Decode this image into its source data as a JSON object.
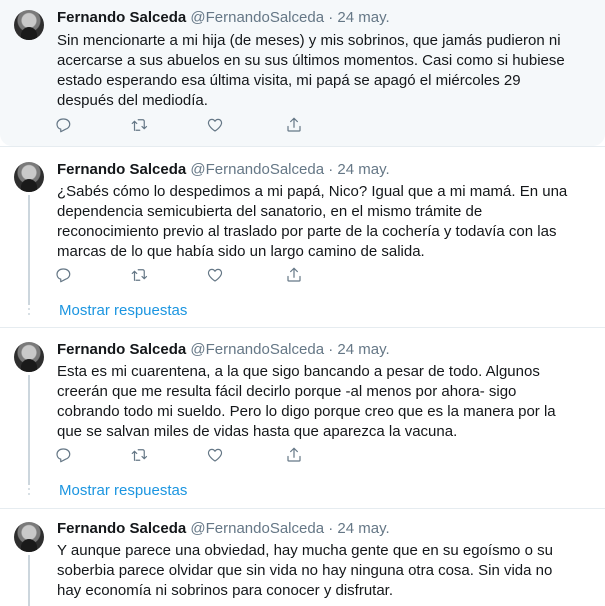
{
  "tweets": [
    {
      "name": "Fernando Salceda",
      "handle": "@FernandoSalceda",
      "dot": "·",
      "date": "24 may.",
      "lines": [
        "Sin mencionarte a mi hija (de meses) y mis sobrinos, que jamás pudieron ni",
        "acercarse a sus abuelos en su sus últimos momentos. Casi como si hubiese",
        "estado esperando esa última visita, mi papá se apagó el miércoles 29",
        "después del mediodía."
      ]
    },
    {
      "name": "Fernando Salceda",
      "handle": "@FernandoSalceda",
      "dot": "·",
      "date": "24 may.",
      "lines": [
        "¿Sabés cómo lo despedimos a mi papá, Nico? Igual que a mi mamá. En una",
        "dependencia semicubierta del sanatorio, en el mismo trámite de",
        "reconocimiento previo al traslado por parte de la cochería y todavía con las",
        "marcas de lo que había sido un largo camino de salida."
      ],
      "show_replies": "Mostrar respuestas"
    },
    {
      "name": "Fernando Salceda",
      "handle": "@FernandoSalceda",
      "dot": "·",
      "date": "24 may.",
      "lines": [
        "Esta es mi cuarentena, a la que sigo bancando a pesar de todo. Algunos",
        "creerán que me resulta fácil decirlo porque -al menos por ahora- sigo",
        "cobrando todo mi sueldo. Pero lo digo porque creo que es la manera por la",
        "que se salvan miles de vidas hasta que aparezca la vacuna."
      ],
      "show_replies": "Mostrar respuestas"
    },
    {
      "name": "Fernando Salceda",
      "handle": "@FernandoSalceda",
      "dot": "·",
      "date": "24 may.",
      "lines": [
        "Y aunque parece una obviedad, hay mucha gente que en su egoísmo o su",
        "soberbia parece olvidar que sin vida no hay ninguna otra cosa. Sin vida no",
        "hay economía ni sobrinos para conocer y disfrutar."
      ]
    }
  ],
  "icons": {
    "reply": "reply-icon",
    "retweet": "retweet-icon",
    "like": "heart-icon",
    "share": "share-icon"
  },
  "colors": {
    "link": "#1b95e0",
    "secondary_text": "#657786",
    "highlight_bg": "#f5f8fa"
  }
}
